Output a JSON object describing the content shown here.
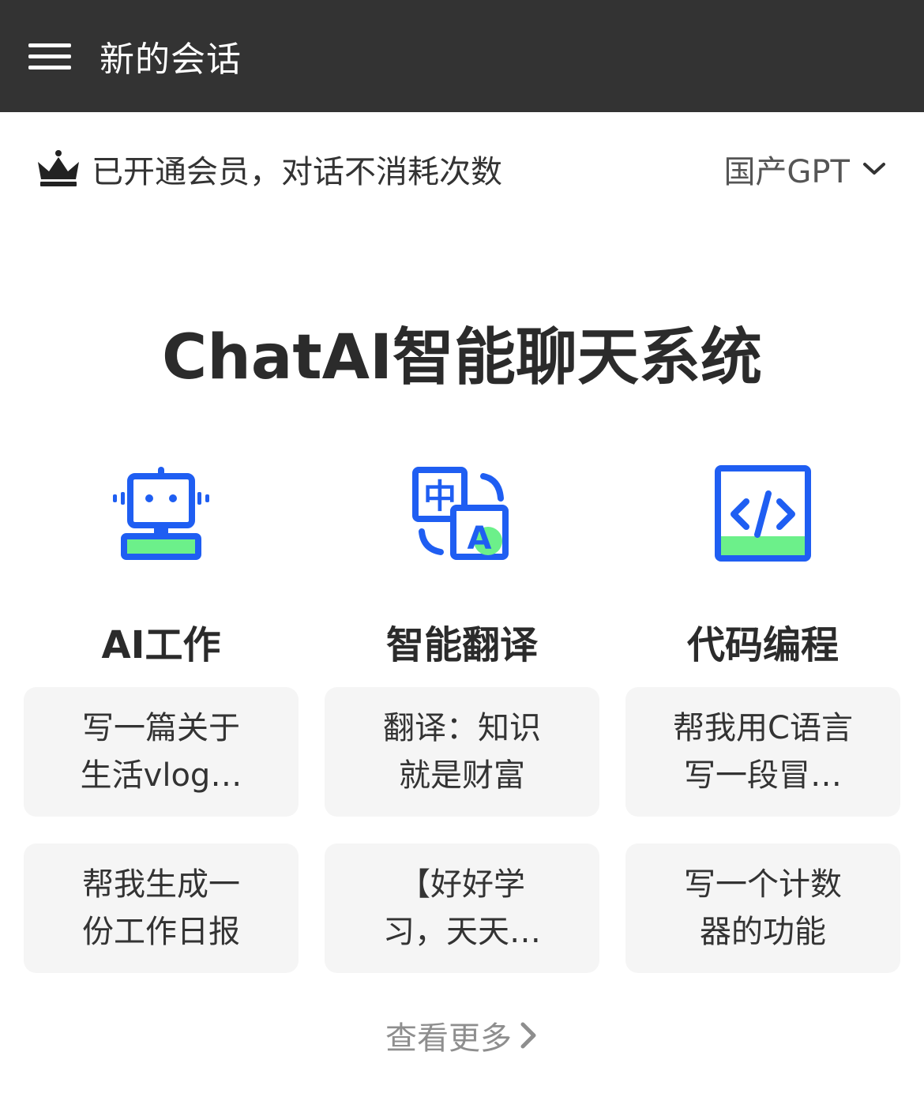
{
  "header": {
    "title": "新的会话",
    "menu_icon": "hamburger-menu-icon"
  },
  "membership": {
    "icon": "crown-icon",
    "text": "已开通会员，对话不消耗次数"
  },
  "model_selector": {
    "selected": "国产GPT",
    "icon": "chevron-down-icon"
  },
  "main": {
    "title": "ChatAI智能聊天系统"
  },
  "features": [
    {
      "label": "AI工作",
      "icon": "robot-icon",
      "prompts": [
        "写一篇关于生活vlog脚本",
        "帮我生成一份工作日报"
      ]
    },
    {
      "label": "智能翻译",
      "icon": "translate-icon",
      "prompts": [
        "翻译：知识就是财富",
        "【好好学习，天天向上】..."
      ]
    },
    {
      "label": "代码编程",
      "icon": "code-icon",
      "prompts": [
        "帮我用C语言写一段冒泡排序",
        "写一个计数器的功能"
      ]
    }
  ],
  "more": {
    "label": "查看更多",
    "icon": "chevron-right-icon"
  },
  "colors": {
    "header_bg": "#333333",
    "icon_blue": "#1f5ef2",
    "icon_green": "#6cf08a",
    "card_bg": "#f5f5f5",
    "muted_text": "#8e8e8e"
  }
}
